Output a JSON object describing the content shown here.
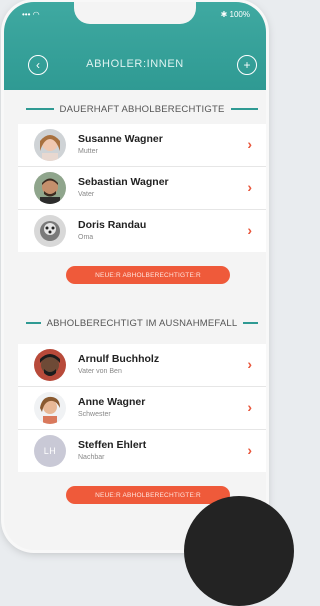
{
  "status": {
    "left": "••• ◠",
    "right": "✱ 100%"
  },
  "nav": {
    "title": "ABHOLER:INNEN",
    "back_icon": "chevron-left-icon",
    "add_icon": "plus-icon"
  },
  "section_permanent": {
    "title": "DAUERHAFT ABHOLBERECHTIGTE",
    "items": [
      {
        "name": "Susanne Wagner",
        "role": "Mutter"
      },
      {
        "name": "Sebastian Wagner",
        "role": "Vater"
      },
      {
        "name": "Doris Randau",
        "role": "Oma"
      }
    ],
    "button": "NEUE:R ABHOLBERECHTIGTE:R"
  },
  "section_exception": {
    "title": "ABHOLBERECHTIGT IM AUSNAHMEFALL",
    "items": [
      {
        "name": "Arnulf Buchholz",
        "role": "Vater von Ben"
      },
      {
        "name": "Anne Wagner",
        "role": "Schwester"
      },
      {
        "name": "Steffen Ehlert",
        "role": "Nachbar",
        "initials": "LH"
      }
    ],
    "button": "NEUE:R ABHOLBERECHTIGTE:R"
  },
  "colors": {
    "accent": "#2f9a93",
    "button": "#ef5a3a",
    "chevron": "#e8553a"
  }
}
